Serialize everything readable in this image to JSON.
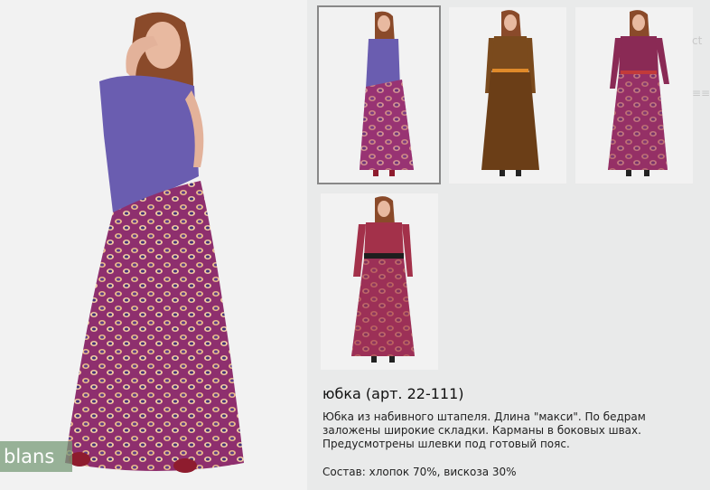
{
  "brand": {
    "name": "blans"
  },
  "edge": {
    "fragment_1": "ct",
    "fragment_2": "≡≡"
  },
  "product": {
    "title": "юбка (арт. 22-111)",
    "description": "Юбка из набивного штапеля. Длина \"макси\". По бедрам заложены широкие складки. Карманы в боковых швах.  Предусмотрены шлевки под готовый пояс.",
    "composition": "Состав: хлопок 70%, вискоза 30%"
  },
  "thumbnails": [
    {
      "name": "purple-top-print-skirt",
      "selected": true
    },
    {
      "name": "brown-print-dress-orange-belt",
      "selected": false
    },
    {
      "name": "blue-red-print-dress",
      "selected": false
    },
    {
      "name": "red-stripe-dress-black-belt",
      "selected": false
    }
  ],
  "colors": {
    "top_purple": "#6a5db0",
    "skirt_magenta": "#8e2f6e",
    "skirt_accent": "#e9b98a",
    "brown_dress": "#7a4a1d",
    "red_dress": "#a3314a",
    "badge": "#7a9b78"
  }
}
